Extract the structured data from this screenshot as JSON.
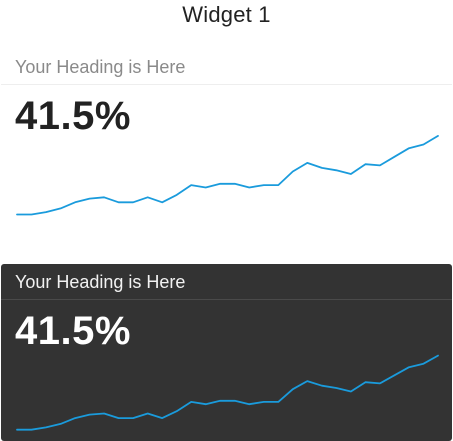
{
  "page": {
    "title": "Widget 1"
  },
  "widgets": [
    {
      "theme": "light",
      "heading": "Your Heading is Here",
      "value": "41.5%"
    },
    {
      "theme": "dark",
      "heading": "Your Heading is Here",
      "value": "41.5%"
    }
  ],
  "colors": {
    "accent": "#1a9bdc",
    "dark_card_bg": "#333333",
    "light_card_bg": "#ffffff"
  },
  "chart_data": {
    "type": "line",
    "series": [
      {
        "values": [
          2,
          2,
          4,
          7,
          12,
          15,
          16,
          12,
          12,
          16,
          12,
          18,
          26,
          24,
          27,
          27,
          24,
          26,
          26,
          37,
          44,
          40,
          38,
          35,
          43,
          42,
          49,
          56,
          59,
          66
        ]
      }
    ],
    "ylim": [
      0,
      70
    ],
    "grid": false,
    "legend": "none"
  }
}
